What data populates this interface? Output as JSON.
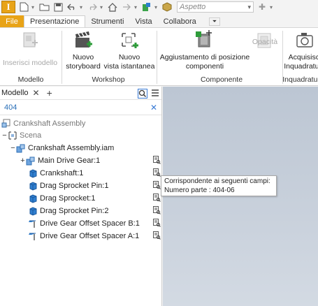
{
  "qat": {
    "app_letter": "I",
    "appearance_value": "Aspetto"
  },
  "tabs": [
    {
      "label": "File"
    },
    {
      "label": "Presentazione"
    },
    {
      "label": "Strumenti"
    },
    {
      "label": "Vista"
    },
    {
      "label": "Collabora"
    }
  ],
  "ribbon": {
    "buttons": {
      "insert_model": "Inserisci modello",
      "new_storyboard_1": "Nuovo",
      "new_storyboard_2": "storyboard",
      "new_snapshot_1": "Nuovo",
      "new_snapshot_2": "vista istantanea",
      "tweak_1": "Aggiustamento di posizione",
      "tweak_2": "componenti",
      "opacity": "Opacità",
      "capture_1": "Acquisisci",
      "capture_2": "Inquadratura"
    },
    "groups": {
      "model": "Modello",
      "workshop": "Workshop",
      "component": "Componente",
      "capture": "Inquadratura"
    }
  },
  "browser": {
    "title": "Modello",
    "filter_value": "404",
    "tree": [
      {
        "label": "Crankshaft Assembly",
        "icon": "assembly-doc-icon"
      },
      {
        "label": "Scena",
        "icon": "scene-icon"
      },
      {
        "label": "Crankshaft Assembly.iam",
        "icon": "assembly-icon"
      },
      {
        "label": "Main Drive Gear:1",
        "icon": "subassembly-icon"
      },
      {
        "label": "Crankshaft:1",
        "icon": "part-icon"
      },
      {
        "label": "Drag Sprocket Pin:1",
        "icon": "part-icon"
      },
      {
        "label": "Drag Sprocket:1",
        "icon": "part-icon"
      },
      {
        "label": "Drag Sprocket Pin:2",
        "icon": "part-icon"
      },
      {
        "label": "Drive Gear Offset Spacer B:1",
        "icon": "content-center-part-icon"
      },
      {
        "label": "Drive Gear Offset Spacer A:1",
        "icon": "content-center-part-icon"
      }
    ]
  },
  "tooltip": {
    "line1": "Corrispondente ai seguenti campi:",
    "line2": "Numero parte : 404-06"
  },
  "colors": {
    "accent": "#e8a317",
    "part_blue": "#2f7fd0",
    "highlight": "#3a7bd5"
  }
}
